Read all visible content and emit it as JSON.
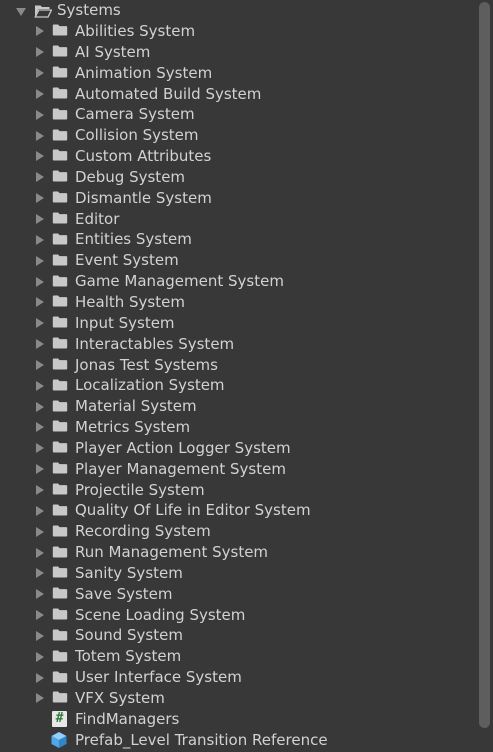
{
  "root": {
    "label": "Systems",
    "icon": "open-folder-icon",
    "expanded": true
  },
  "folders": [
    "Abilities System",
    "AI System",
    "Animation System",
    "Automated Build System",
    "Camera System",
    "Collision System",
    "Custom Attributes",
    "Debug System",
    "Dismantle System",
    "Editor",
    "Entities System",
    "Event System",
    "Game Management System",
    "Health System",
    "Input System",
    "Interactables System",
    "Jonas Test Systems",
    "Localization System",
    "Material System",
    "Metrics System",
    "Player Action Logger System",
    "Player Management System",
    "Projectile System",
    "Quality Of Life in Editor System",
    "Recording System",
    "Run Management System",
    "Sanity System",
    "Save System",
    "Scene Loading System",
    "Sound System",
    "Totem System",
    "User Interface System",
    "VFX System"
  ],
  "assets": [
    {
      "label": "FindManagers",
      "icon": "csharp-script-icon",
      "glyph": "#"
    },
    {
      "label": "Prefab_Level Transition Reference",
      "icon": "prefab-cube-icon"
    }
  ],
  "colors": {
    "background": "#383838",
    "text": "#d2d2d2",
    "folder": "#c8c8c8",
    "arrow": "#8a8a8a",
    "prefab": "#4fa8e8",
    "script_glyph": "#2e7d3a",
    "scroll_thumb": "#5e5e5e"
  }
}
